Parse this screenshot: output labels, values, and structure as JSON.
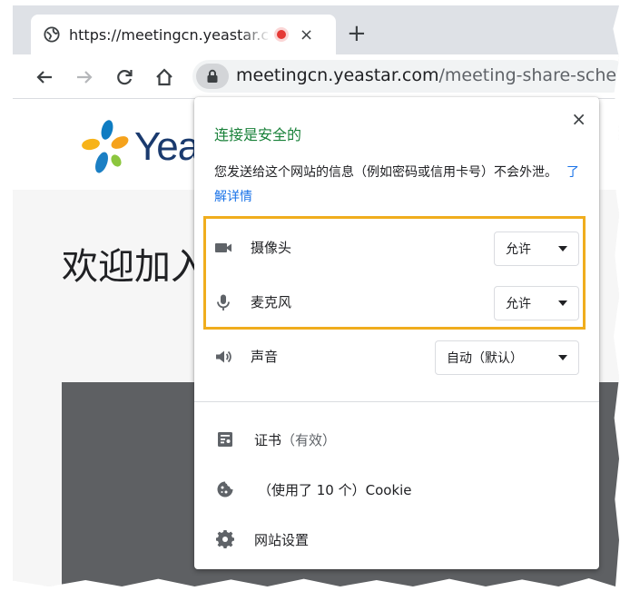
{
  "browser": {
    "tab": {
      "title": "https://meetingcn.yeastar.com/meeting-share-schedule",
      "close": "×"
    },
    "new_tab": "+",
    "address": {
      "host": "meetingcn.yeastar.com",
      "path": "/meeting-share-schedu"
    }
  },
  "page": {
    "logo_text": "Yea",
    "welcome": "欢迎加入"
  },
  "site_info": {
    "close": "×",
    "title": "连接是安全的",
    "description": "您发送给这个网站的信息（例如密码或信用卡号）不会外泄。",
    "learn_more": "了解详情",
    "permissions": [
      {
        "icon": "camera-icon",
        "label": "摄像头",
        "value": "允许"
      },
      {
        "icon": "microphone-icon",
        "label": "麦克风",
        "value": "允许"
      },
      {
        "icon": "speaker-icon",
        "label": "声音",
        "value": "自动（默认）"
      }
    ],
    "certificate": {
      "label": "证书",
      "status": "（有效）"
    },
    "cookies": {
      "label": "（使用了 10 个）Cookie"
    },
    "site_settings": {
      "label": "网站设置"
    }
  },
  "colors": {
    "secure_green": "#188038",
    "link_blue": "#1a73e8",
    "highlight_orange": "#f0ad1d"
  }
}
